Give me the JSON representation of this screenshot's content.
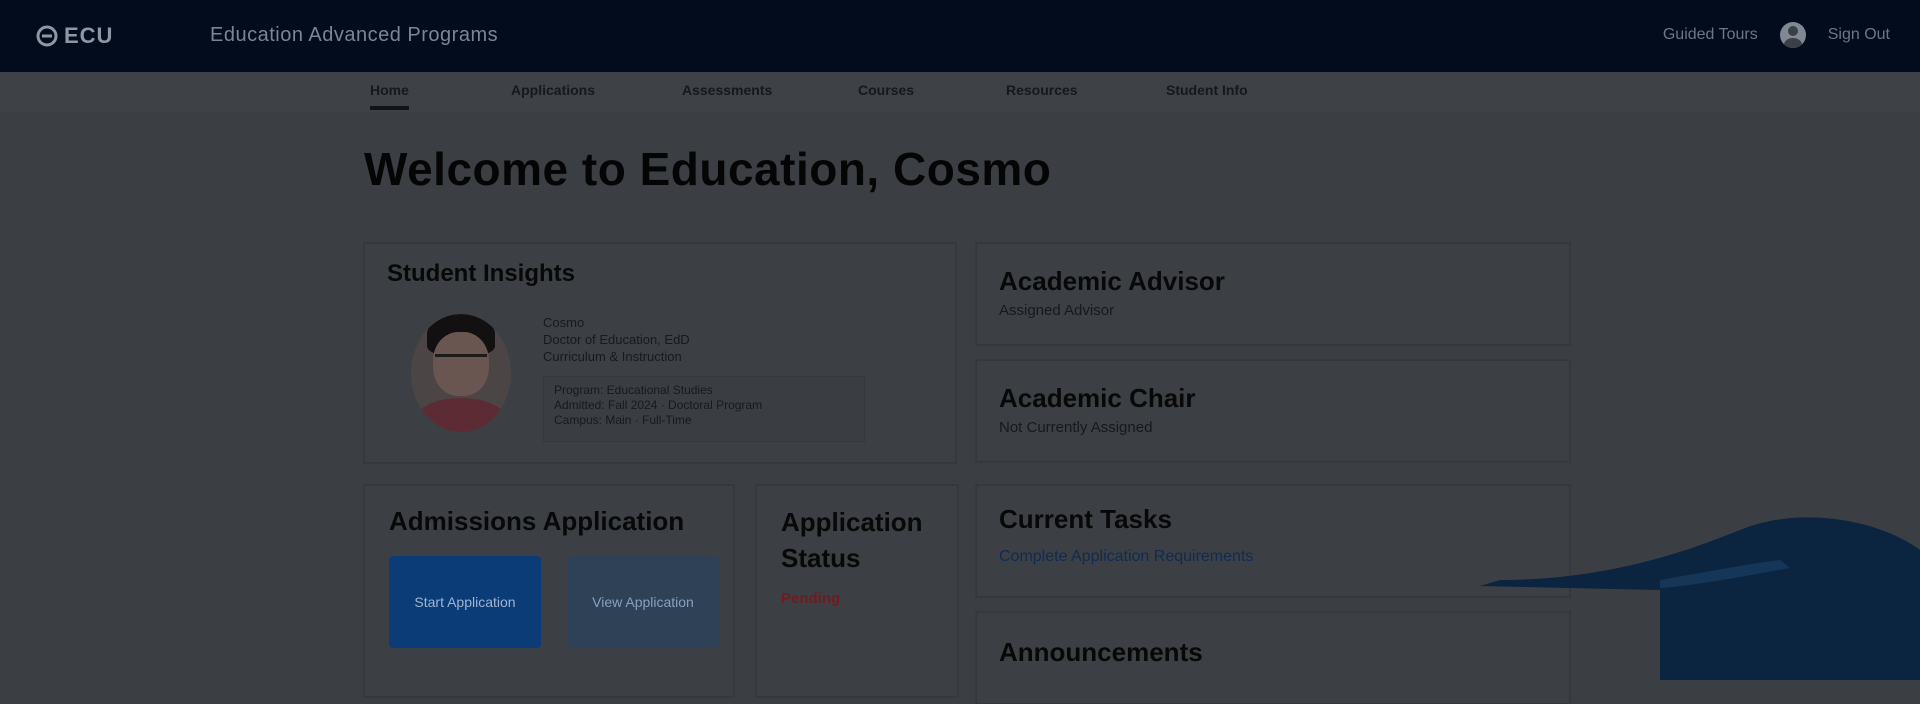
{
  "header": {
    "logo_text": "ECU",
    "title": "Education Advanced Programs",
    "help": "Guided Tours",
    "sign_out": "Sign Out"
  },
  "nav": {
    "tabs": [
      {
        "label": "Home",
        "active": true
      },
      {
        "label": "Applications",
        "active": false
      },
      {
        "label": "Assessments",
        "active": false
      },
      {
        "label": "Courses",
        "active": false
      },
      {
        "label": "Resources",
        "active": false
      },
      {
        "label": "Student Info",
        "active": false
      }
    ]
  },
  "page": {
    "title": "Welcome to Education, Cosmo"
  },
  "insights": {
    "title": "Student Insights",
    "lines": [
      "Cosmo",
      "Doctor of Education, EdD",
      "Curriculum & Instruction"
    ],
    "box_lines": [
      "Program: Educational Studies",
      "Admitted: Fall 2024 · Doctoral Program",
      "Campus: Main · Full-Time"
    ]
  },
  "advisor": {
    "title": "Academic Advisor",
    "subtitle": "Assigned Advisor"
  },
  "chair": {
    "title": "Academic Chair",
    "subtitle": "Not Currently Assigned"
  },
  "admissions": {
    "title": "Admissions Application",
    "primary_label": "Start Application",
    "secondary_label": "View Application"
  },
  "status": {
    "title": "Application Status",
    "badge": "Pending"
  },
  "tasks": {
    "title": "Current Tasks",
    "link": "Complete Application Requirements"
  },
  "announcements": {
    "title": "Announcements"
  },
  "colors": {
    "topbar": "#020c1c",
    "primary_button": "#0b3c77",
    "status_badge": "#6f1c20",
    "link": "#0f2b52"
  }
}
